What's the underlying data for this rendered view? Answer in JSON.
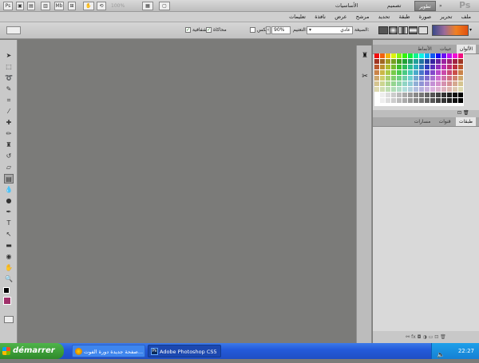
{
  "appbar": {
    "zoom": "100%",
    "workspaces": [
      "الأساسيات",
      "تصميم",
      "تطوير"
    ],
    "logo": "Ps"
  },
  "menubar": {
    "items": [
      "ملف",
      "تحرير",
      "صورة",
      "طبقة",
      "تحديد",
      "مرشح",
      "عرض",
      "نافذة",
      "تعليمات"
    ]
  },
  "options": {
    "style_label": "الصيغة:",
    "style_value": "عادي",
    "opacity_label": "التعتيم:",
    "opacity_value": "90%",
    "reverse_label": "عكس",
    "dither_label": "محاكاة",
    "transparency_label": "شفافية"
  },
  "panels": {
    "top_tabs": [
      "الألوان",
      "عينات",
      "الأنماط"
    ],
    "bottom_tabs": [
      "طبقات",
      "قنوات",
      "مسارات"
    ]
  },
  "taskbar": {
    "start": "démarrer",
    "tasks": [
      "صفحة جديدة دورة الفوت...",
      "Adobe Photoshop CS5"
    ],
    "time": "22:27"
  }
}
